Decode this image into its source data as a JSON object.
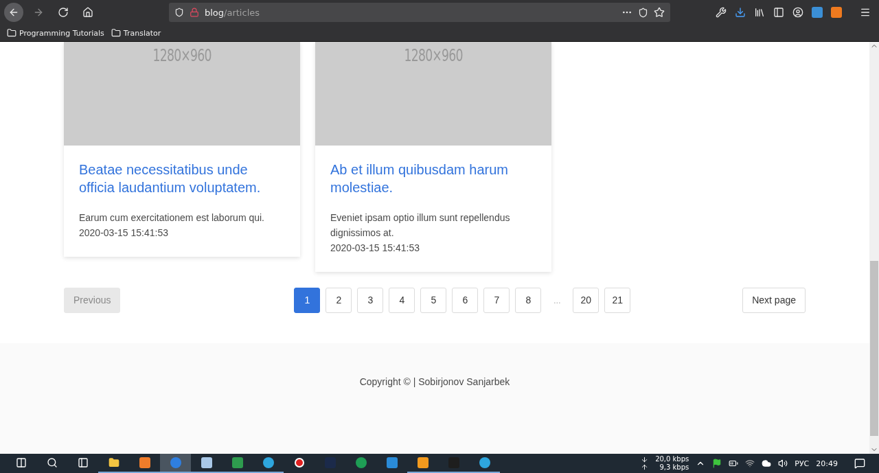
{
  "browser": {
    "url_host": "blog",
    "url_path": "/articles",
    "bookmarks": [
      {
        "label": "Programming Tutorials"
      },
      {
        "label": "Translator"
      }
    ]
  },
  "cards": [
    {
      "image_label": "1280×960",
      "title": "Beatae necessitatibus unde officia laudantium voluptatem.",
      "excerpt": "Earum cum exercitationem est laborum qui.",
      "date": "2020-03-15 15:41:53"
    },
    {
      "image_label": "1280×960",
      "title": "Ab et illum quibusdam harum molestiae.",
      "excerpt": "Eveniet ipsam optio illum sunt repellendus dignissimos at.",
      "date": "2020-03-15 15:41:53"
    }
  ],
  "pagination": {
    "previous": {
      "label": "Previous",
      "disabled": true
    },
    "pages": [
      {
        "label": "1",
        "kind": "page",
        "selected": true
      },
      {
        "label": "2",
        "kind": "page",
        "selected": false
      },
      {
        "label": "3",
        "kind": "page",
        "selected": false
      },
      {
        "label": "4",
        "kind": "page",
        "selected": false
      },
      {
        "label": "5",
        "kind": "page",
        "selected": false
      },
      {
        "label": "6",
        "kind": "page",
        "selected": false
      },
      {
        "label": "7",
        "kind": "page",
        "selected": false
      },
      {
        "label": "8",
        "kind": "page",
        "selected": false
      },
      {
        "label": "...",
        "kind": "ellipsis"
      },
      {
        "label": "20",
        "kind": "page",
        "selected": false
      },
      {
        "label": "21",
        "kind": "page",
        "selected": false
      }
    ],
    "next": {
      "label": "Next page",
      "disabled": false
    }
  },
  "footer": {
    "text": "Copyright © | Sobirjonov Sanjarbek"
  },
  "taskbar": {
    "apps": [
      {
        "kind": "folder",
        "color": "#f4c542",
        "running": true,
        "active": false
      },
      {
        "kind": "app",
        "color": "#f07c2a",
        "running": true,
        "active": false
      },
      {
        "kind": "browser",
        "color": "#2f7fe0",
        "running": true,
        "active": true
      },
      {
        "kind": "app",
        "color": "#a9c8e8",
        "running": true,
        "active": false
      },
      {
        "kind": "app",
        "color": "#2e9b4e",
        "running": true,
        "active": false
      },
      {
        "kind": "round",
        "color": "#2ea6de",
        "running": true,
        "active": false
      },
      {
        "kind": "record",
        "color": "#e02020",
        "running": false,
        "active": false
      },
      {
        "kind": "app",
        "color": "#1b2a4a",
        "running": false,
        "active": false
      },
      {
        "kind": "round",
        "color": "#1e9e55",
        "running": false,
        "active": false
      },
      {
        "kind": "app",
        "color": "#2a8bd8",
        "running": false,
        "active": false
      },
      {
        "kind": "app",
        "color": "#f39a1e",
        "running": true,
        "active": false
      },
      {
        "kind": "app",
        "color": "#1e1e1e",
        "running": true,
        "active": false
      },
      {
        "kind": "round",
        "color": "#2ea6de",
        "running": true,
        "active": false
      }
    ],
    "net_down": "20,0 kbps",
    "net_up": "9,3 kbps",
    "language": "РУС",
    "time": "20:49"
  }
}
